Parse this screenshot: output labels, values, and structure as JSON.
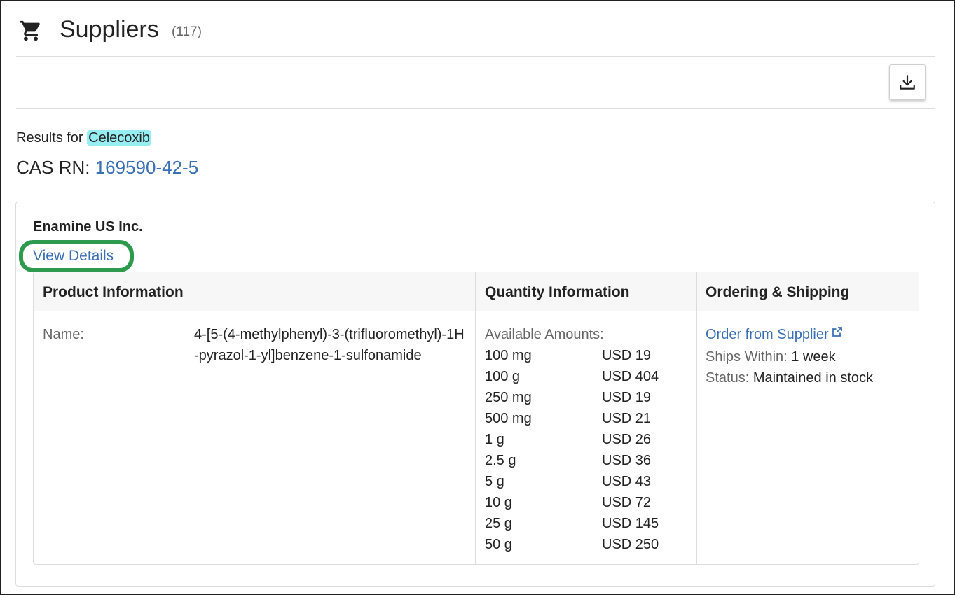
{
  "header": {
    "title": "Suppliers",
    "count": "(117)"
  },
  "toolbar": {
    "download_icon": "download-icon"
  },
  "results": {
    "prefix": "Results for",
    "query": "Celecoxib",
    "cas_label": "CAS RN:",
    "cas_value": "169590-42-5"
  },
  "supplier": {
    "name": "Enamine US Inc.",
    "view_details": "View Details",
    "columns": {
      "product": "Product Information",
      "quantity": "Quantity Information",
      "ordering": "Ordering & Shipping"
    },
    "product": {
      "name_label": "Name:",
      "name_value": "4-[5-(4-methylphenyl)-3-(trifluoromethyl)-1H-pyrazol-1-yl]benzene-1-sulfonamide"
    },
    "quantity": {
      "label": "Available Amounts:",
      "amounts": [
        {
          "qty": "100 mg",
          "price": "USD 19"
        },
        {
          "qty": "100 g",
          "price": "USD 404"
        },
        {
          "qty": "250 mg",
          "price": "USD 19"
        },
        {
          "qty": "500 mg",
          "price": "USD 21"
        },
        {
          "qty": "1 g",
          "price": "USD 26"
        },
        {
          "qty": "2.5 g",
          "price": "USD 36"
        },
        {
          "qty": "5 g",
          "price": "USD 43"
        },
        {
          "qty": "10 g",
          "price": "USD 72"
        },
        {
          "qty": "25 g",
          "price": "USD 145"
        },
        {
          "qty": "50 g",
          "price": "USD 250"
        }
      ]
    },
    "ordering": {
      "order_link": "Order from Supplier",
      "ships_label": "Ships Within:",
      "ships_value": "1 week",
      "status_label": "Status:",
      "status_value": "Maintained in stock"
    }
  },
  "colors": {
    "link": "#3b70b4",
    "highlight": "#97eef2",
    "annotation_ring": "#2e9a4e"
  }
}
